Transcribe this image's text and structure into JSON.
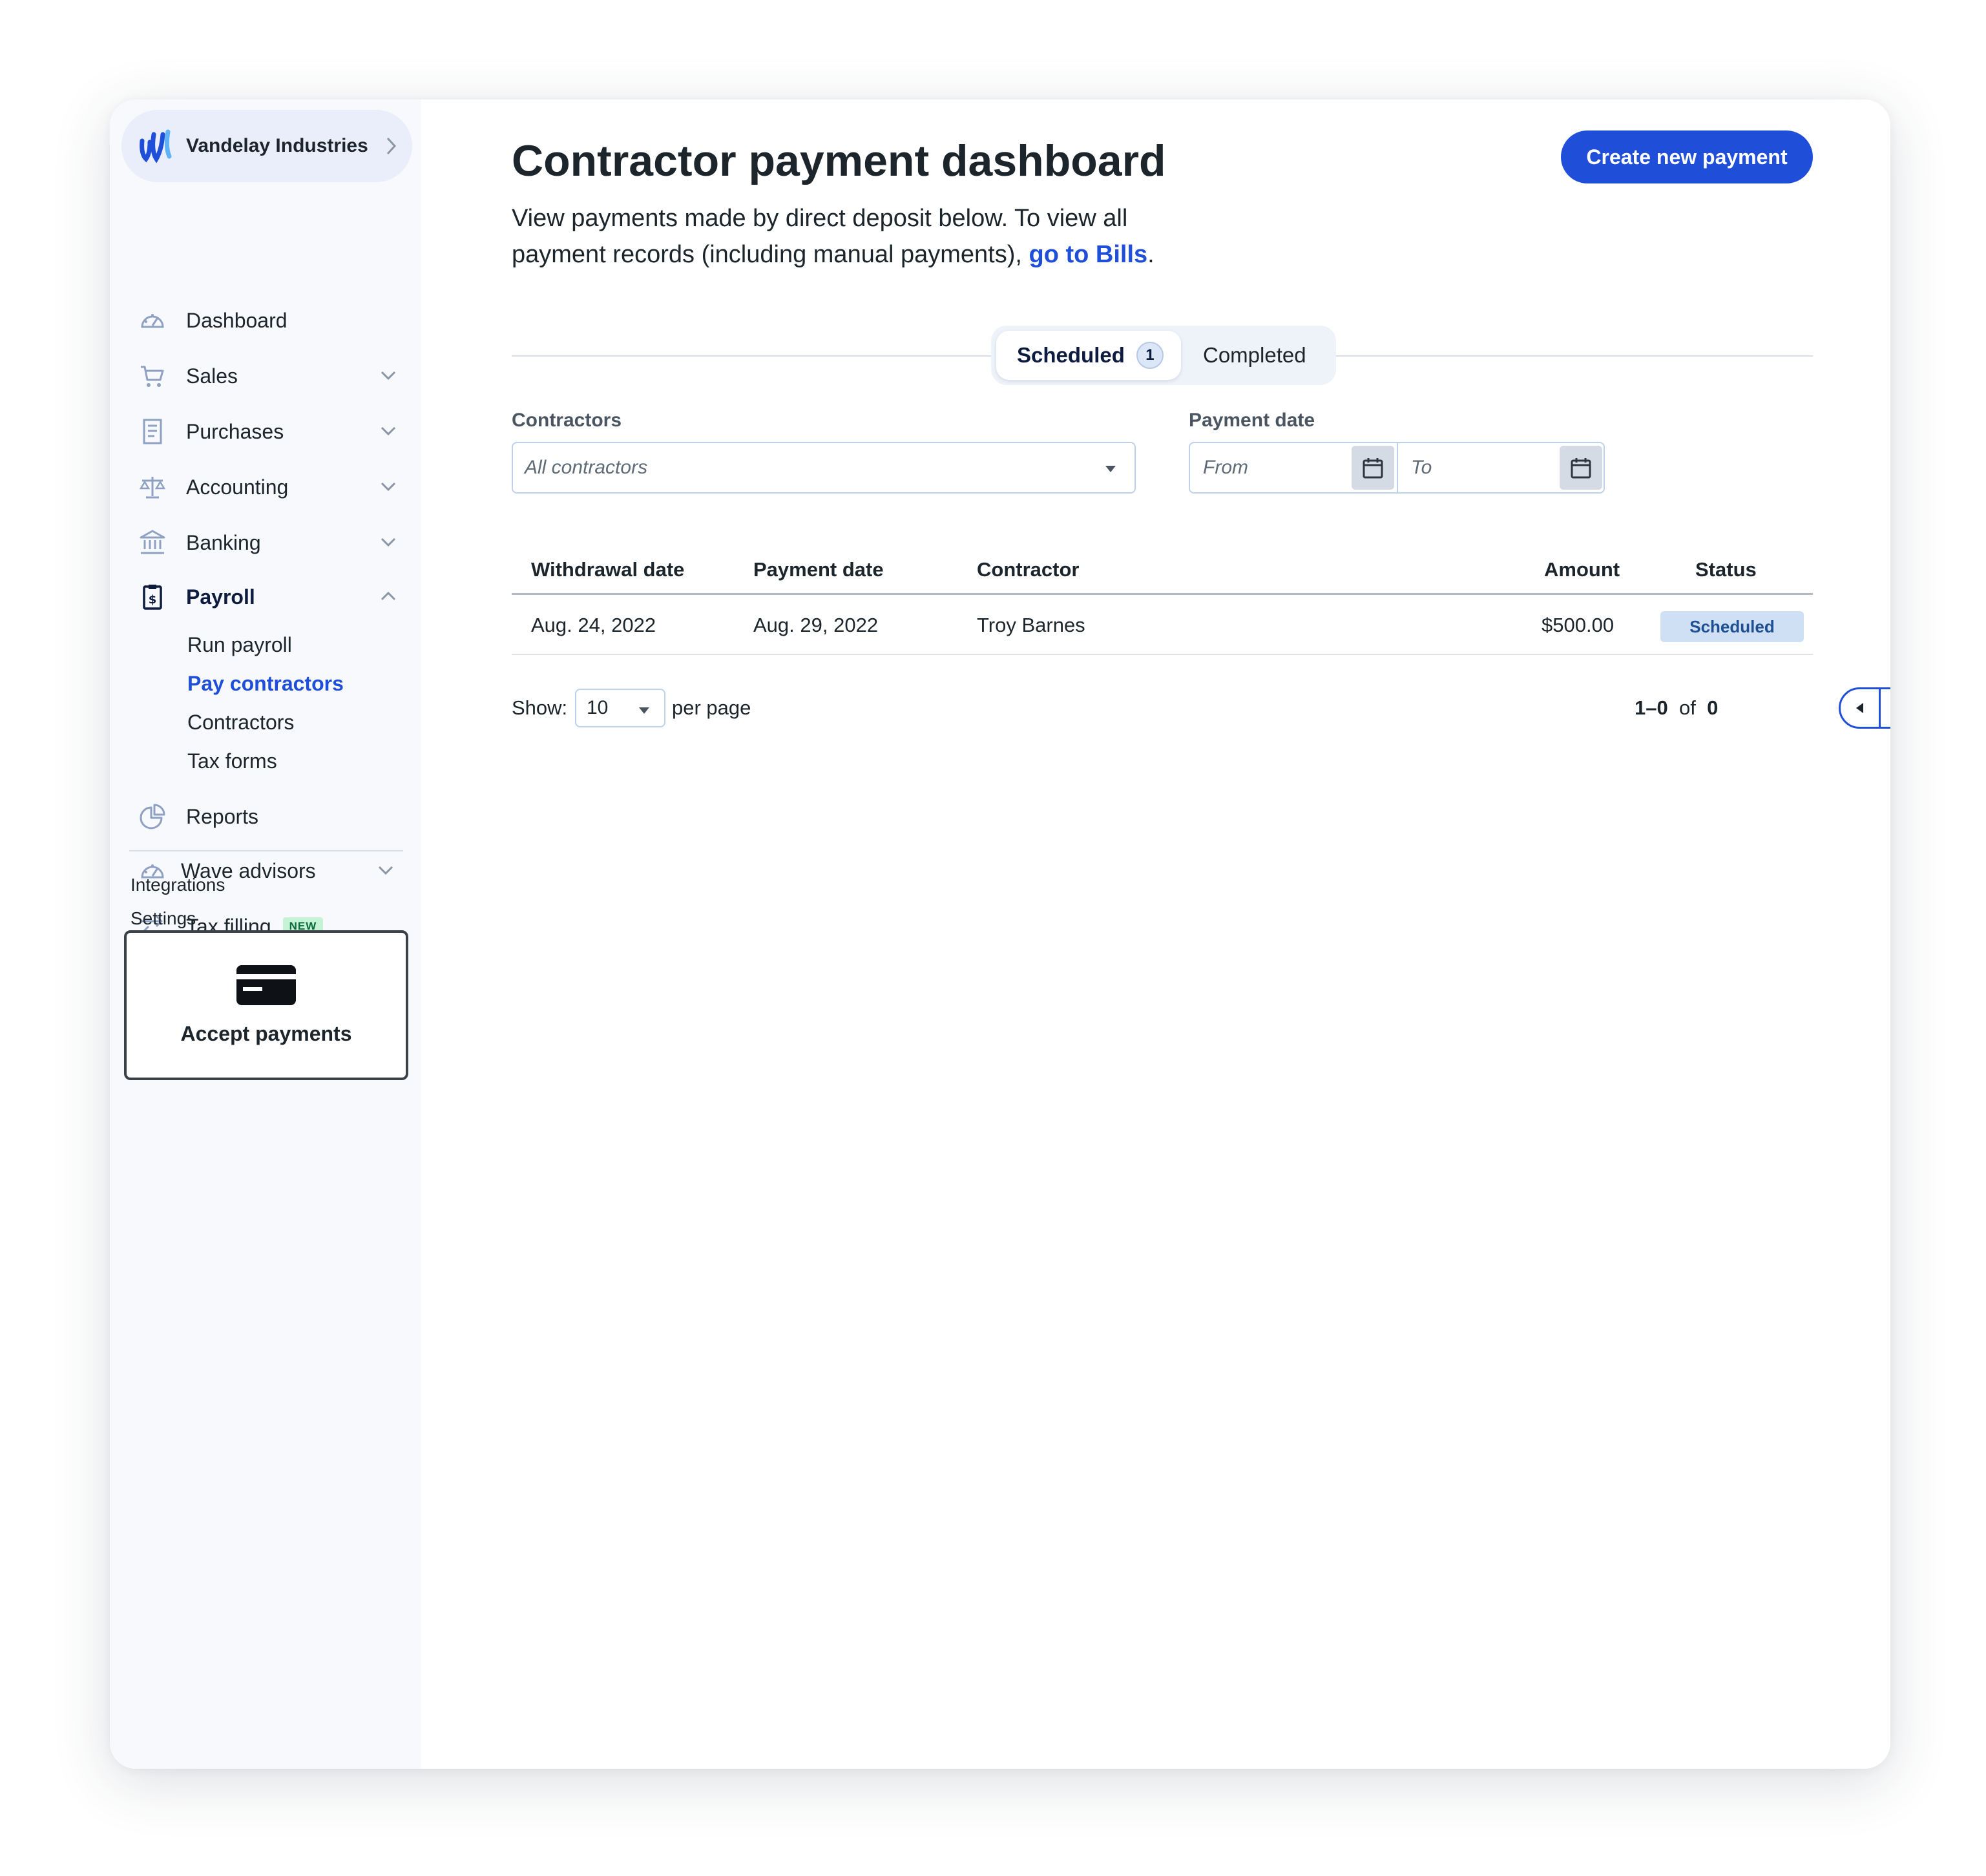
{
  "business": {
    "name": "Vandelay Industries"
  },
  "sidebar": {
    "items": [
      {
        "label": "Dashboard",
        "icon": "gauge-icon"
      },
      {
        "label": "Sales",
        "icon": "cart-icon"
      },
      {
        "label": "Purchases",
        "icon": "receipt-icon"
      },
      {
        "label": "Accounting",
        "icon": "scale-icon"
      },
      {
        "label": "Banking",
        "icon": "bank-icon"
      },
      {
        "label": "Payroll",
        "icon": "clipboard-dollar-icon"
      },
      {
        "label": "Reports",
        "icon": "pie-chart-icon"
      },
      {
        "label": "Wave advisors",
        "icon": "gauge-icon"
      },
      {
        "label": "Tax filling",
        "icon": "swap-arrows-icon",
        "badge": "NEW"
      }
    ],
    "payroll_sub": [
      "Run payroll",
      "Pay contractors",
      "Contractors",
      "Tax forms"
    ],
    "footer_links": [
      "Integrations",
      "Settings"
    ],
    "accept_payments": "Accept payments"
  },
  "main": {
    "title": "Contractor payment dashboard",
    "description": "View payments made by direct deposit below. To view all payment records (including manual payments), ",
    "description_link": "go to Bills",
    "description_end": ".",
    "create_button": "Create new payment",
    "tabs": [
      {
        "label": "Scheduled",
        "count": "1"
      },
      {
        "label": "Completed"
      }
    ],
    "filters": {
      "contractors_label": "Contractors",
      "contractors_value": "All contractors",
      "date_label": "Payment date",
      "from_placeholder": "From",
      "to_placeholder": "To"
    },
    "table": {
      "headers": [
        "Withdrawal date",
        "Payment date",
        "Contractor",
        "Amount",
        "Status"
      ],
      "rows": [
        [
          "Aug. 24, 2022",
          "Aug. 29, 2022",
          "Troy Barnes",
          "$500.00",
          "Scheduled"
        ]
      ]
    },
    "pagination": {
      "show_label": "Show:",
      "per_page_value": "10",
      "per_page_label": "per page",
      "range": "1–0",
      "of": "of",
      "total": "0"
    }
  },
  "colors": {
    "accent": "#1f4ed8",
    "sidebar_bg": "#f7f9fd",
    "status_bg": "#cfe0f5",
    "new_badge": "#c6f2d6"
  }
}
